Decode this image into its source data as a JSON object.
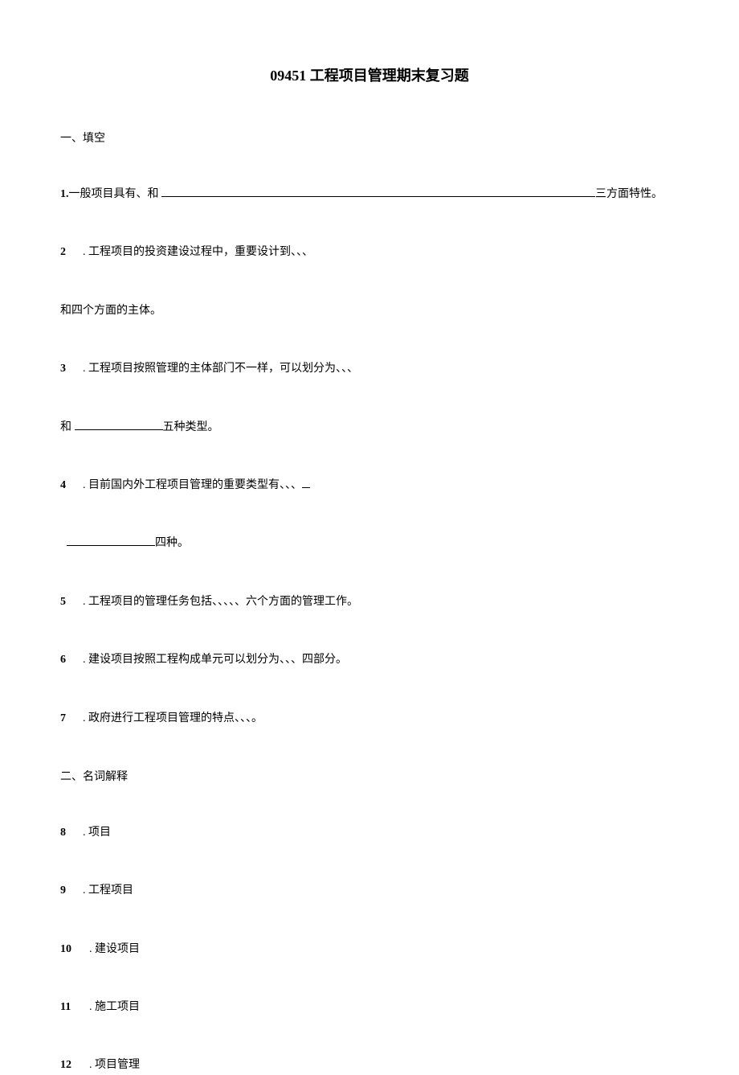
{
  "title": "09451 工程项目管理期末复习题",
  "section1": {
    "heading": "一、填空",
    "q1_prefix": "1.",
    "q1_text_a": "一般项目具有、和 ",
    "q1_text_b": "三方面特性。",
    "q2_num": "2",
    "q2_text": " . 工程项目的投资建设过程中，重要设计到、、、",
    "q2_sub": "和四个方面的主体。",
    "q3_num": "3",
    "q3_text": " . 工程项目按照管理的主体部门不一样，可以划分为、、、",
    "q3_sub_a": "和 ",
    "q3_sub_b": "五种类型。",
    "q4_num": "4",
    "q4_text": " . 目前国内外工程项目管理的重要类型有、、、",
    "q4_sub_b": "四种。",
    "q5_num": "5",
    "q5_text": " . 工程项目的管理任务包括、、、、、六个方面的管理工作。",
    "q6_num": "6",
    "q6_text": " . 建设项目按照工程构成单元可以划分为、、、四部分。",
    "q7_num": "7",
    "q7_text": " . 政府进行工程项目管理的特点、、、。"
  },
  "section2": {
    "heading": "二、名词解释",
    "q8_num": "8",
    "q8_text": " . 项目",
    "q9_num": "9",
    "q9_text": " . 工程项目",
    "q10_num": "10",
    "q10_text": " . 建设项目",
    "q11_num": "11",
    "q11_text": " . 施工项目",
    "q12_num": "12",
    "q12_text": " . 项目管理"
  }
}
